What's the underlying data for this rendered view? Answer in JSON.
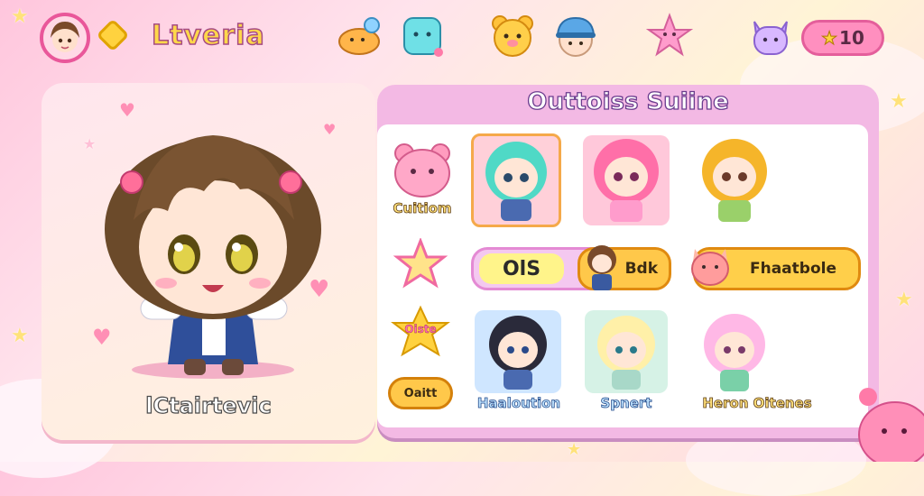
{
  "header": {
    "title": "Ltveria",
    "stars_label": "10",
    "icons": [
      "avatar-icon",
      "gem-icon",
      "bird-icon",
      "cube-icon",
      "bear-icon",
      "cap-icon",
      "star-face-icon",
      "cat-icon"
    ]
  },
  "character": {
    "name": "lCtairtevic"
  },
  "panel": {
    "title": "Outtoiss Suiine",
    "row1": {
      "side_label": "Cuitiom"
    },
    "row2": {
      "pill_value": "OlS",
      "pill_b_label": "Bdk",
      "pill_c_label": "Fhaatbole"
    },
    "row3": {
      "side_label": "Oiste",
      "side_button": "Oaitt",
      "label_1": "Haaloution",
      "label_2": "Spnert",
      "label_3": "Heron Oitenes"
    }
  },
  "colors": {
    "accent_pink": "#e9579a",
    "gold": "#ffd84a",
    "panel_purple": "#f3b9e4"
  }
}
